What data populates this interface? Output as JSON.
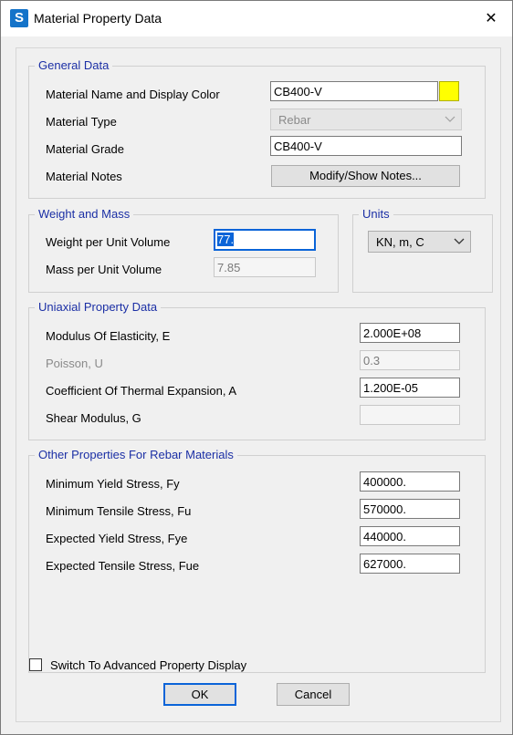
{
  "window": {
    "title": "Material Property Data",
    "app_icon_letter": "S",
    "close_glyph": "✕"
  },
  "general": {
    "legend": "General Data",
    "name_label": "Material Name and Display Color",
    "name_value": "CB400-V",
    "display_color": "#ffff00",
    "type_label": "Material Type",
    "type_value": "Rebar",
    "grade_label": "Material Grade",
    "grade_value": "CB400-V",
    "notes_label": "Material Notes",
    "notes_button": "Modify/Show Notes..."
  },
  "weight": {
    "legend": "Weight and Mass",
    "weight_label": "Weight per Unit Volume",
    "weight_value": "77.",
    "mass_label": "Mass per Unit Volume",
    "mass_value": "7.85"
  },
  "units": {
    "legend": "Units",
    "value": "KN, m, C"
  },
  "uniaxial": {
    "legend": "Uniaxial Property Data",
    "e_label": "Modulus Of Elasticity,  E",
    "e_value": "2.000E+08",
    "u_label": "Poisson,  U",
    "u_value": "0.3",
    "a_label": "Coefficient Of Thermal Expansion,  A",
    "a_value": "1.200E-05",
    "g_label": "Shear Modulus,  G",
    "g_value": ""
  },
  "rebar": {
    "legend": "Other Properties For Rebar Materials",
    "fy_label": "Minimum Yield Stress, Fy",
    "fy_value": "400000.",
    "fu_label": "Minimum Tensile Stress, Fu",
    "fu_value": "570000.",
    "fye_label": "Expected Yield Stress, Fye",
    "fye_value": "440000.",
    "fue_label": "Expected Tensile Stress, Fue",
    "fue_value": "627000."
  },
  "advanced_checkbox": {
    "label": "Switch To Advanced Property Display",
    "checked": false
  },
  "buttons": {
    "ok": "OK",
    "cancel": "Cancel"
  },
  "icons": {
    "chevron": "chevron-down-icon",
    "close": "close-icon"
  }
}
